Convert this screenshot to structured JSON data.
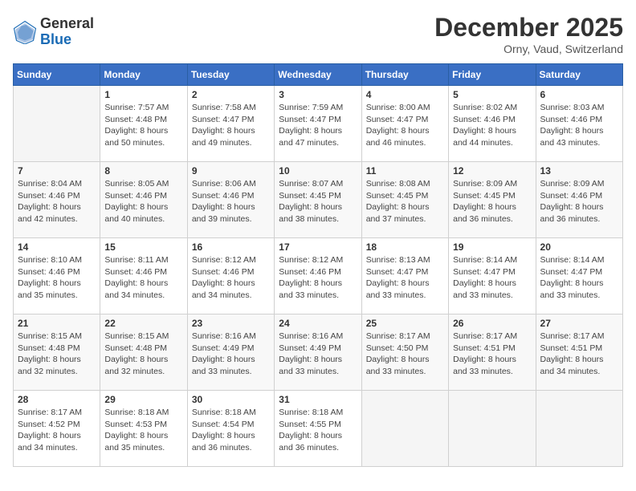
{
  "logo": {
    "general": "General",
    "blue": "Blue"
  },
  "title": "December 2025",
  "location": "Orny, Vaud, Switzerland",
  "weekdays": [
    "Sunday",
    "Monday",
    "Tuesday",
    "Wednesday",
    "Thursday",
    "Friday",
    "Saturday"
  ],
  "weeks": [
    [
      {
        "day": "",
        "sunrise": "",
        "sunset": "",
        "daylight": ""
      },
      {
        "day": "1",
        "sunrise": "Sunrise: 7:57 AM",
        "sunset": "Sunset: 4:48 PM",
        "daylight": "Daylight: 8 hours and 50 minutes."
      },
      {
        "day": "2",
        "sunrise": "Sunrise: 7:58 AM",
        "sunset": "Sunset: 4:47 PM",
        "daylight": "Daylight: 8 hours and 49 minutes."
      },
      {
        "day": "3",
        "sunrise": "Sunrise: 7:59 AM",
        "sunset": "Sunset: 4:47 PM",
        "daylight": "Daylight: 8 hours and 47 minutes."
      },
      {
        "day": "4",
        "sunrise": "Sunrise: 8:00 AM",
        "sunset": "Sunset: 4:47 PM",
        "daylight": "Daylight: 8 hours and 46 minutes."
      },
      {
        "day": "5",
        "sunrise": "Sunrise: 8:02 AM",
        "sunset": "Sunset: 4:46 PM",
        "daylight": "Daylight: 8 hours and 44 minutes."
      },
      {
        "day": "6",
        "sunrise": "Sunrise: 8:03 AM",
        "sunset": "Sunset: 4:46 PM",
        "daylight": "Daylight: 8 hours and 43 minutes."
      }
    ],
    [
      {
        "day": "7",
        "sunrise": "Sunrise: 8:04 AM",
        "sunset": "Sunset: 4:46 PM",
        "daylight": "Daylight: 8 hours and 42 minutes."
      },
      {
        "day": "8",
        "sunrise": "Sunrise: 8:05 AM",
        "sunset": "Sunset: 4:46 PM",
        "daylight": "Daylight: 8 hours and 40 minutes."
      },
      {
        "day": "9",
        "sunrise": "Sunrise: 8:06 AM",
        "sunset": "Sunset: 4:46 PM",
        "daylight": "Daylight: 8 hours and 39 minutes."
      },
      {
        "day": "10",
        "sunrise": "Sunrise: 8:07 AM",
        "sunset": "Sunset: 4:45 PM",
        "daylight": "Daylight: 8 hours and 38 minutes."
      },
      {
        "day": "11",
        "sunrise": "Sunrise: 8:08 AM",
        "sunset": "Sunset: 4:45 PM",
        "daylight": "Daylight: 8 hours and 37 minutes."
      },
      {
        "day": "12",
        "sunrise": "Sunrise: 8:09 AM",
        "sunset": "Sunset: 4:45 PM",
        "daylight": "Daylight: 8 hours and 36 minutes."
      },
      {
        "day": "13",
        "sunrise": "Sunrise: 8:09 AM",
        "sunset": "Sunset: 4:46 PM",
        "daylight": "Daylight: 8 hours and 36 minutes."
      }
    ],
    [
      {
        "day": "14",
        "sunrise": "Sunrise: 8:10 AM",
        "sunset": "Sunset: 4:46 PM",
        "daylight": "Daylight: 8 hours and 35 minutes."
      },
      {
        "day": "15",
        "sunrise": "Sunrise: 8:11 AM",
        "sunset": "Sunset: 4:46 PM",
        "daylight": "Daylight: 8 hours and 34 minutes."
      },
      {
        "day": "16",
        "sunrise": "Sunrise: 8:12 AM",
        "sunset": "Sunset: 4:46 PM",
        "daylight": "Daylight: 8 hours and 34 minutes."
      },
      {
        "day": "17",
        "sunrise": "Sunrise: 8:12 AM",
        "sunset": "Sunset: 4:46 PM",
        "daylight": "Daylight: 8 hours and 33 minutes."
      },
      {
        "day": "18",
        "sunrise": "Sunrise: 8:13 AM",
        "sunset": "Sunset: 4:47 PM",
        "daylight": "Daylight: 8 hours and 33 minutes."
      },
      {
        "day": "19",
        "sunrise": "Sunrise: 8:14 AM",
        "sunset": "Sunset: 4:47 PM",
        "daylight": "Daylight: 8 hours and 33 minutes."
      },
      {
        "day": "20",
        "sunrise": "Sunrise: 8:14 AM",
        "sunset": "Sunset: 4:47 PM",
        "daylight": "Daylight: 8 hours and 33 minutes."
      }
    ],
    [
      {
        "day": "21",
        "sunrise": "Sunrise: 8:15 AM",
        "sunset": "Sunset: 4:48 PM",
        "daylight": "Daylight: 8 hours and 32 minutes."
      },
      {
        "day": "22",
        "sunrise": "Sunrise: 8:15 AM",
        "sunset": "Sunset: 4:48 PM",
        "daylight": "Daylight: 8 hours and 32 minutes."
      },
      {
        "day": "23",
        "sunrise": "Sunrise: 8:16 AM",
        "sunset": "Sunset: 4:49 PM",
        "daylight": "Daylight: 8 hours and 33 minutes."
      },
      {
        "day": "24",
        "sunrise": "Sunrise: 8:16 AM",
        "sunset": "Sunset: 4:49 PM",
        "daylight": "Daylight: 8 hours and 33 minutes."
      },
      {
        "day": "25",
        "sunrise": "Sunrise: 8:17 AM",
        "sunset": "Sunset: 4:50 PM",
        "daylight": "Daylight: 8 hours and 33 minutes."
      },
      {
        "day": "26",
        "sunrise": "Sunrise: 8:17 AM",
        "sunset": "Sunset: 4:51 PM",
        "daylight": "Daylight: 8 hours and 33 minutes."
      },
      {
        "day": "27",
        "sunrise": "Sunrise: 8:17 AM",
        "sunset": "Sunset: 4:51 PM",
        "daylight": "Daylight: 8 hours and 34 minutes."
      }
    ],
    [
      {
        "day": "28",
        "sunrise": "Sunrise: 8:17 AM",
        "sunset": "Sunset: 4:52 PM",
        "daylight": "Daylight: 8 hours and 34 minutes."
      },
      {
        "day": "29",
        "sunrise": "Sunrise: 8:18 AM",
        "sunset": "Sunset: 4:53 PM",
        "daylight": "Daylight: 8 hours and 35 minutes."
      },
      {
        "day": "30",
        "sunrise": "Sunrise: 8:18 AM",
        "sunset": "Sunset: 4:54 PM",
        "daylight": "Daylight: 8 hours and 36 minutes."
      },
      {
        "day": "31",
        "sunrise": "Sunrise: 8:18 AM",
        "sunset": "Sunset: 4:55 PM",
        "daylight": "Daylight: 8 hours and 36 minutes."
      },
      {
        "day": "",
        "sunrise": "",
        "sunset": "",
        "daylight": ""
      },
      {
        "day": "",
        "sunrise": "",
        "sunset": "",
        "daylight": ""
      },
      {
        "day": "",
        "sunrise": "",
        "sunset": "",
        "daylight": ""
      }
    ]
  ]
}
